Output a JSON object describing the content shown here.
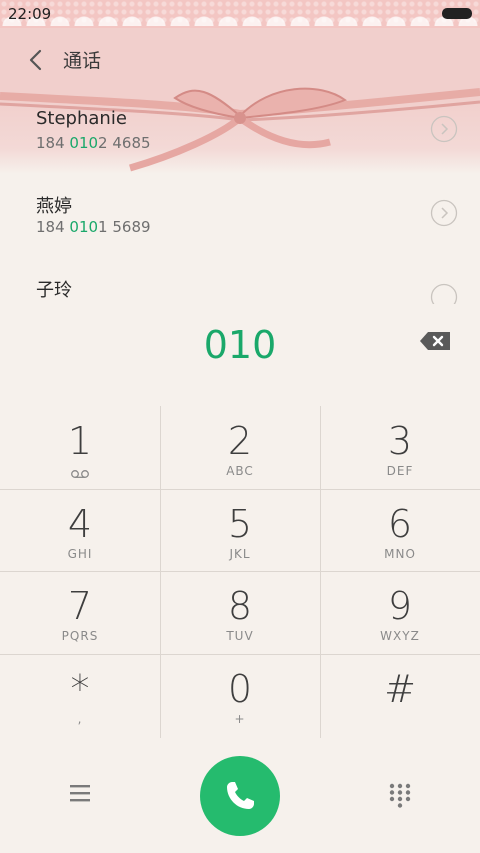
{
  "status": {
    "time": "22:09"
  },
  "header": {
    "title": "通话"
  },
  "contacts": [
    {
      "name": "Stephanie",
      "number_prefix": "184 ",
      "number_match": "010",
      "number_suffix": "2 4685"
    },
    {
      "name": "燕婷",
      "number_prefix": "184 ",
      "number_match": "010",
      "number_suffix": "1 5689"
    },
    {
      "name": "子玲"
    }
  ],
  "dial": {
    "entered": "010"
  },
  "keys": [
    {
      "digit": "1",
      "letters": ""
    },
    {
      "digit": "2",
      "letters": "ABC"
    },
    {
      "digit": "3",
      "letters": "DEF"
    },
    {
      "digit": "4",
      "letters": "GHI"
    },
    {
      "digit": "5",
      "letters": "JKL"
    },
    {
      "digit": "6",
      "letters": "MNO"
    },
    {
      "digit": "7",
      "letters": "PQRS"
    },
    {
      "digit": "8",
      "letters": "TUV"
    },
    {
      "digit": "9",
      "letters": "WXYZ"
    },
    {
      "digit": "*",
      "letters": ","
    },
    {
      "digit": "0",
      "letters": "+"
    },
    {
      "digit": "#",
      "letters": ""
    }
  ],
  "colors": {
    "accent": "#1aa86a",
    "call": "#25bb6e",
    "header_bg": "#f1cfcc"
  },
  "icons": {
    "back": "back-arrow-icon",
    "detail": "chevron-circle-icon",
    "backspace": "backspace-icon",
    "voicemail": "voicemail-icon",
    "menu": "menu-icon",
    "call": "phone-icon",
    "dialpad": "dialpad-icon"
  }
}
